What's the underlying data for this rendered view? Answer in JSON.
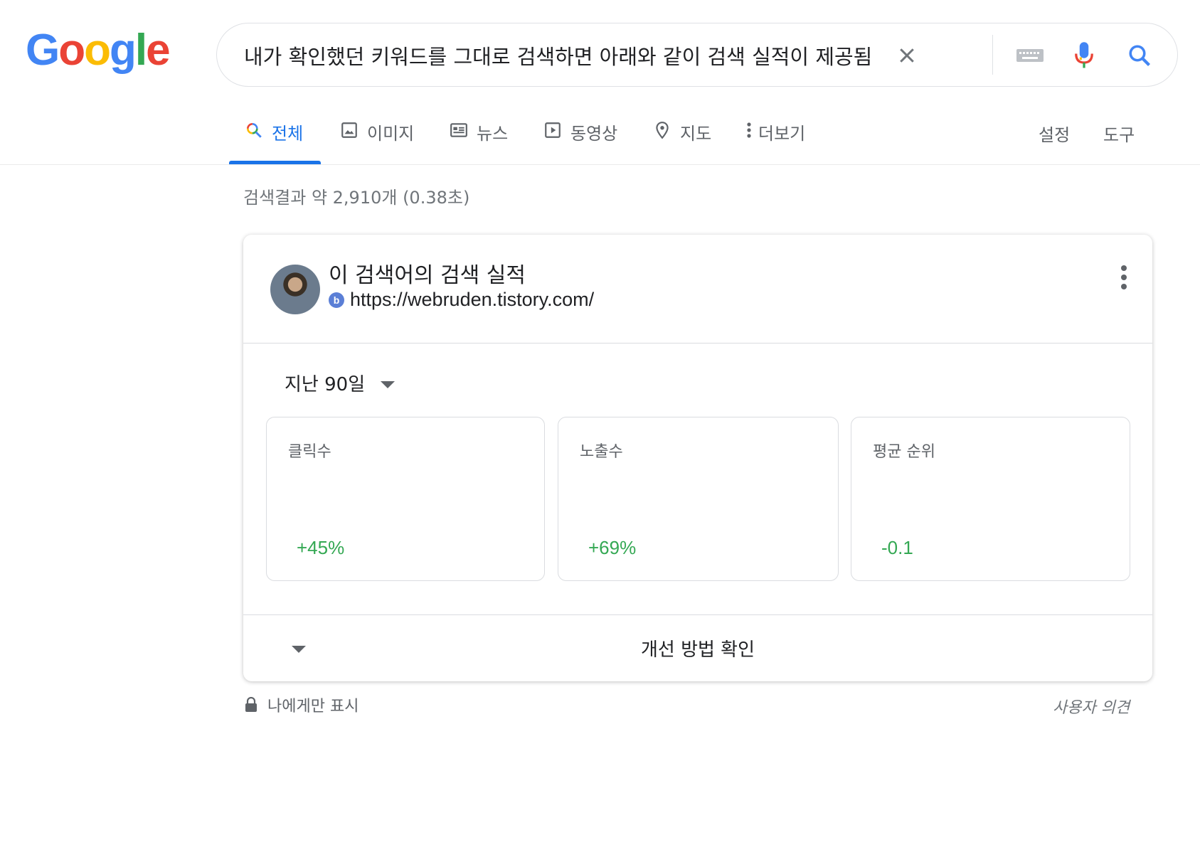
{
  "logo": {
    "letters": [
      {
        "ch": "G",
        "color": "#4285F4"
      },
      {
        "ch": "o",
        "color": "#EA4335"
      },
      {
        "ch": "o",
        "color": "#FBBC05"
      },
      {
        "ch": "g",
        "color": "#4285F4"
      },
      {
        "ch": "l",
        "color": "#34A853"
      },
      {
        "ch": "e",
        "color": "#EA4335"
      }
    ]
  },
  "search": {
    "query": "내가 확인했던 키워드를 그대로 검색하면 아래와 같이 검색 실적이 제공됨"
  },
  "tabs": [
    {
      "label": "전체",
      "icon": "search-icon",
      "active": true
    },
    {
      "label": "이미지",
      "icon": "image-icon"
    },
    {
      "label": "뉴스",
      "icon": "news-icon"
    },
    {
      "label": "동영상",
      "icon": "video-icon"
    },
    {
      "label": "지도",
      "icon": "map-pin-icon"
    },
    {
      "label": "더보기",
      "icon": "more-vert-icon"
    }
  ],
  "tools": {
    "settings": "설정",
    "tools": "도구"
  },
  "result_stats": "검색결과 약 2,910개 (0.38초)",
  "card": {
    "title": "이 검색어의 검색 실적",
    "site_url": "https://webruden.tistory.com/",
    "period": "지난 90일",
    "metrics": [
      {
        "label": "클릭수",
        "value": "+45%"
      },
      {
        "label": "노출수",
        "value": "+69%"
      },
      {
        "label": "평균 순위",
        "value": "-0.1"
      }
    ],
    "improve_label": "개선 방법 확인"
  },
  "footer": {
    "private_label": "나에게만 표시",
    "feedback_label": "사용자 의견"
  },
  "colors": {
    "accent": "#1a73e8",
    "positive": "#34a853"
  }
}
